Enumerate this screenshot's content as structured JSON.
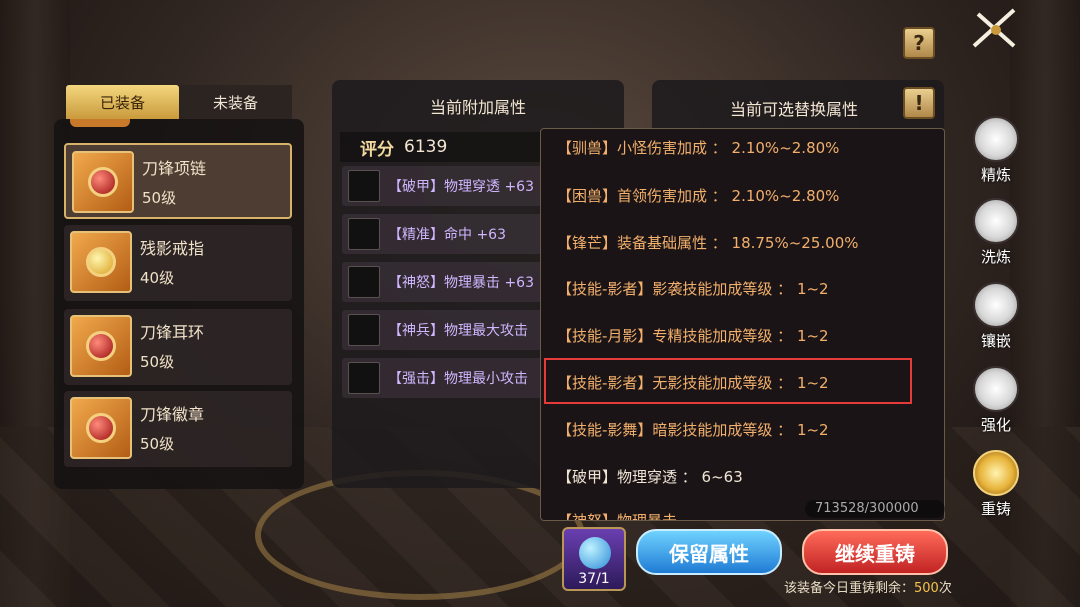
{
  "left": {
    "tabs": [
      {
        "label": "已装备",
        "active": true
      },
      {
        "label": "未装备",
        "active": false
      }
    ],
    "items": [
      {
        "name": "刀锋项链",
        "level": "50级",
        "selected": true
      },
      {
        "name": "残影戒指",
        "level": "40级",
        "selected": false
      },
      {
        "name": "刀锋耳环",
        "level": "50级",
        "selected": false
      },
      {
        "name": "刀锋徽章",
        "level": "50级",
        "selected": false
      }
    ]
  },
  "middle": {
    "title": "当前附加属性",
    "score_label": "评分",
    "score_value": "6139",
    "attributes": [
      "【破甲】物理穿透 +63",
      "【精准】命中 +63",
      "【神怒】物理暴击 +63",
      "【神兵】物理最大攻击",
      "【强击】物理最小攻击"
    ]
  },
  "right": {
    "title": "当前可选替换属性",
    "options": [
      "【驯兽】小怪伤害加成 ： 2.10%~2.80%",
      "【困兽】首领伤害加成 ： 2.10%~2.80%",
      "【锋芒】装备基础属性 ： 18.75%~25.00%",
      "【技能-影者】影袭技能加成等级 ： 1~2",
      "【技能-月影】专精技能加成等级 ： 1~2",
      "【技能-影者】无影技能加成等级 ： 1~2",
      "【技能-影舞】暗影技能加成等级 ： 1~2",
      "【破甲】物理穿透 ： 6~63",
      "【神怒】物理暴击"
    ],
    "highlighted_index": 5
  },
  "bottom": {
    "crystal_count": "37/1",
    "counter_text": "713528/300000",
    "keep_button": "保留属性",
    "continue_button": "继续重铸",
    "remain_prefix": "该装备今日重铸剩余：",
    "remain_count": "500",
    "remain_suffix": "次"
  },
  "side_menu": [
    {
      "label": "精炼",
      "icon": "refine-icon",
      "active": false
    },
    {
      "label": "洗炼",
      "icon": "wash-icon",
      "active": false
    },
    {
      "label": "镶嵌",
      "icon": "inlay-icon",
      "active": false
    },
    {
      "label": "强化",
      "icon": "enhance-icon",
      "active": false
    },
    {
      "label": "重铸",
      "icon": "recast-icon",
      "active": true
    }
  ],
  "help_buttons": [
    "?",
    "!"
  ],
  "colors": {
    "accent_gold": "#d7b36a",
    "option_text": "#f3b06c",
    "attr_text": "#cfb6ff",
    "highlight_border": "#e53b3b"
  }
}
